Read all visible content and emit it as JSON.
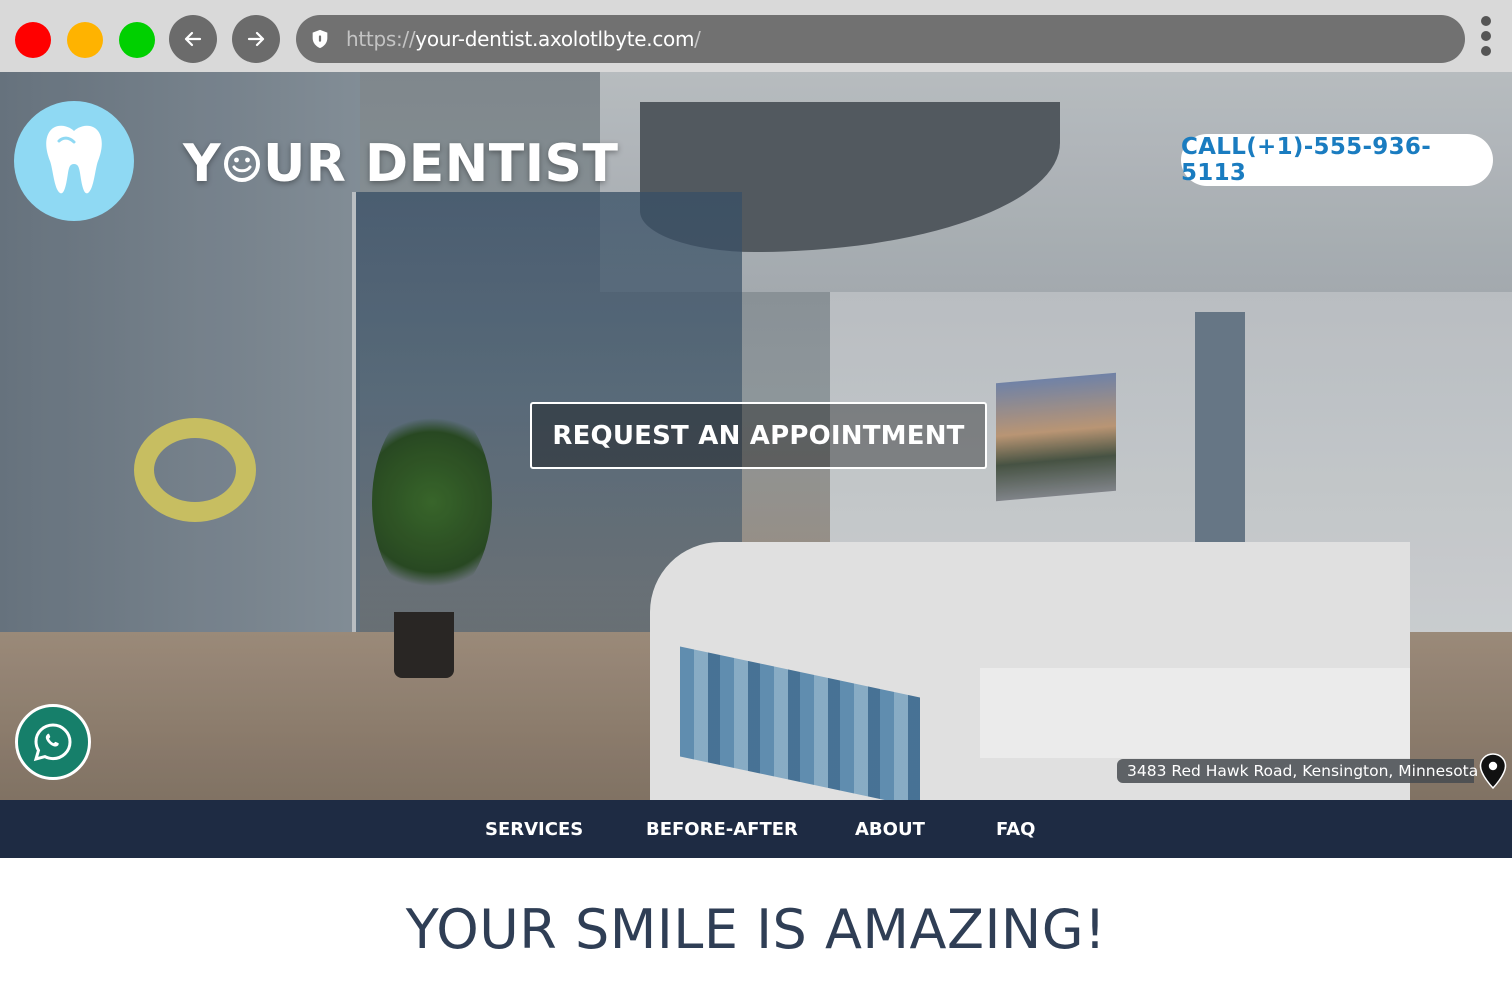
{
  "browser": {
    "url_scheme": "https://",
    "url_host": "your-dentist.axolotlbyte.com",
    "url_trailing": "/",
    "traffic_lights": {
      "close": "#ff0000",
      "minimize": "#ffb300",
      "maximize": "#00d000"
    },
    "icons": {
      "back": "arrow-left-icon",
      "forward": "arrow-right-icon",
      "security": "shield-icon",
      "menu": "kebab-menu-icon"
    }
  },
  "header": {
    "brand_prefix": "Y",
    "brand_suffix": "UR DENTIST",
    "logo_icon": "tooth-icon",
    "call_label": "CALL(+1)-555-936-5113"
  },
  "hero": {
    "cta_label": "REQUEST AN APPOINTMENT",
    "address": "3483 Red Hawk Road, Kensington, Minnesota",
    "whatsapp_icon": "whatsapp-icon",
    "pin_icon": "map-pin-icon"
  },
  "nav": {
    "items": [
      {
        "label": "SERVICES"
      },
      {
        "label": "BEFORE-AFTER"
      },
      {
        "label": "ABOUT"
      },
      {
        "label": "FAQ"
      }
    ]
  },
  "main": {
    "headline": "YOUR SMILE IS AMAZING!"
  },
  "colors": {
    "chrome_bg": "#d9d9d9",
    "url_bar": "#717171",
    "logo_badge": "#8fd9f3",
    "call_text": "#1a7cc0",
    "nav_bg": "#1e2b43",
    "headline": "#2f3e55",
    "whatsapp": "#167f6a"
  }
}
